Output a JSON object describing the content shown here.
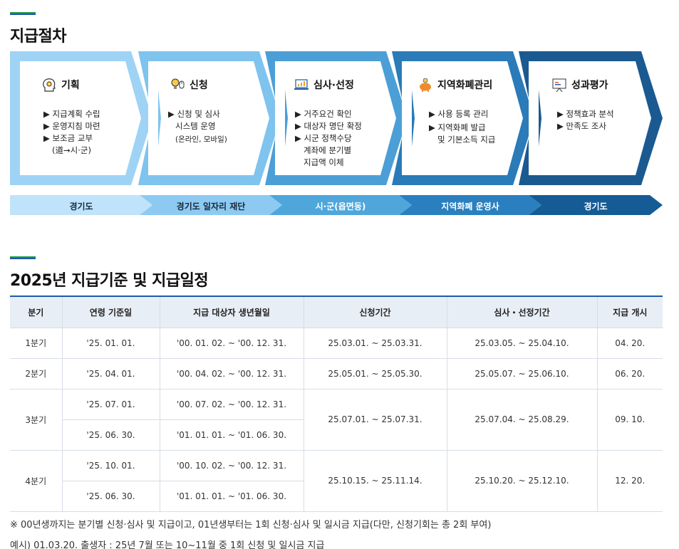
{
  "section1": {
    "title": "지급절차"
  },
  "steps": [
    {
      "title": "기획",
      "icon": "head-gear-icon",
      "items": [
        "▶ 지급계획 수립",
        "▶ 운영지침 마련",
        "▶ 보조금 교부"
      ],
      "sub": "(道→시·군)",
      "note": ""
    },
    {
      "title": "신청",
      "icon": "lightbulb-mouse-icon",
      "items": [
        "▶ 신청 및 심사",
        "시스템 운영"
      ],
      "sub": "",
      "note": "(온라인, 모바일)"
    },
    {
      "title": "심사·선정",
      "icon": "laptop-chart-icon",
      "items": [
        "▶ 거주요건 확인",
        "▶ 대상자 명단 확정",
        "▶ 시군 정책수당"
      ],
      "sub": "계좌에 분기별\n지급액 이체",
      "note": ""
    },
    {
      "title": "지역화폐관리",
      "icon": "piggy-bank-icon",
      "items": [
        "▶ 사용 등록 관리",
        "▶ 지역화폐 발급"
      ],
      "sub": "및 기본소득  지급",
      "note": ""
    },
    {
      "title": "성과평가",
      "icon": "presentation-board-icon",
      "items": [
        "▶ 정책효과 분석",
        "▶ 만족도 조사"
      ],
      "sub": "",
      "note": ""
    }
  ],
  "agencies": [
    "경기도",
    "경기도 일자리 재단",
    "시·군(읍면동)",
    "지역화폐 운영사",
    "경기도"
  ],
  "section2": {
    "title": "2025년 지급기준 및 지급일정"
  },
  "table": {
    "headers": [
      "분기",
      "연령 기준일",
      "지급 대상자 생년월일",
      "신청기간",
      "심사・선정기간",
      "지급 개시"
    ],
    "rows": [
      {
        "quarter": "1분기",
        "base": [
          "'25. 01. 01."
        ],
        "birth": [
          "'00. 01. 02. ~ '00. 12. 31."
        ],
        "apply": "25.03.01. ~ 25.03.31.",
        "review": "25.03.05. ~ 25.04.10.",
        "pay": "04. 20."
      },
      {
        "quarter": "2분기",
        "base": [
          "'25. 04. 01."
        ],
        "birth": [
          "'00. 04. 02. ~ '00. 12. 31."
        ],
        "apply": "25.05.01. ~ 25.05.30.",
        "review": "25.05.07. ~ 25.06.10.",
        "pay": "06. 20."
      },
      {
        "quarter": "3분기",
        "base": [
          "'25. 07. 01.",
          "'25. 06. 30."
        ],
        "birth": [
          "'00. 07. 02. ~ '00. 12. 31.",
          "'01. 01. 01. ~ '01. 06. 30."
        ],
        "apply": "25.07.01. ~ 25.07.31.",
        "review": "25.07.04. ~ 25.08.29.",
        "pay": "09. 10."
      },
      {
        "quarter": "4분기",
        "base": [
          "'25. 10. 01.",
          "'25. 06. 30."
        ],
        "birth": [
          "'00. 10. 02. ~ '00. 12. 31.",
          "'01. 01. 01. ~ '01. 06. 30."
        ],
        "apply": "25.10.15. ~ 25.11.14.",
        "review": "25.10.20. ~ 25.12.10.",
        "pay": "12. 20."
      }
    ]
  },
  "notes": [
    "※ 00년생까지는 분기별 신청·심사 및 지급이고, 01년생부터는 1회 신청·심사 및 일시금 지급(다만, 신청기회는 총 2회 부여)",
    "예시) 01.03.20. 출생자 : 25년 7월 또는 10~11월 중 1회 신청 및 일시금 지급"
  ],
  "colors": {
    "step_outer": [
      "#9fd3f5",
      "#7fc3ef",
      "#4b9fd6",
      "#2a7bb8",
      "#1a5a91"
    ],
    "agency": [
      "#bfe3fa",
      "#8dcaf2",
      "#4fa6db",
      "#2a7fbf",
      "#155b95"
    ],
    "header_bg": "#e8eef6",
    "accent_green": "#1a9a4a",
    "accent_blue": "#1f5aa8"
  }
}
